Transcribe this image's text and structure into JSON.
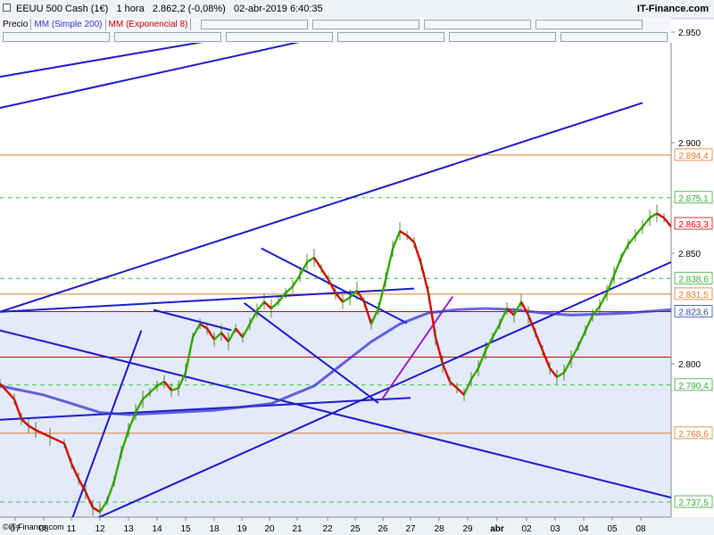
{
  "header": {
    "symbol": "EEUU 500 Cash (1€)",
    "timeframe": "1 hora",
    "price": "2.862,2 (-0,08%)",
    "datetime": "02-abr-2019 6:40:35",
    "brand": "IT-Finance.com"
  },
  "legend": {
    "items": [
      {
        "label": "Precio",
        "color": "#000000"
      },
      {
        "label": "MM (Simple 200)",
        "color": "#3333cc"
      },
      {
        "label": "MM (Exponencial 8)",
        "color": "#cc0000"
      }
    ]
  },
  "footer": {
    "copyright": "©IT-Finance.com"
  },
  "chart_data": {
    "type": "line",
    "x_ticks": [
      "07",
      "08",
      "11",
      "12",
      "13",
      "14",
      "15",
      "18",
      "19",
      "20",
      "21",
      "22",
      "25",
      "26",
      "27",
      "28",
      "29",
      "abr",
      "02",
      "03",
      "04",
      "05",
      "08"
    ],
    "y_ticks": [
      "2.950",
      "2.900",
      "2.850",
      "2.800"
    ],
    "ylim": [
      2730,
      2957
    ],
    "levels": [
      {
        "value": 2894.4,
        "label": "2.894,4",
        "color": "#e07a2a",
        "style": "solid",
        "label_color": "#e07a2a"
      },
      {
        "value": 2875.1,
        "label": "2.875,1",
        "color": "#33cc33",
        "style": "dashed",
        "label_color": "#33aa33"
      },
      {
        "value": 2863.3,
        "label": "2.863,3",
        "color": "#cc0000",
        "style": "none",
        "label_color": "#cc0000"
      },
      {
        "value": 2838.6,
        "label": "2.838,6",
        "color": "#33cc33",
        "style": "dashed",
        "label_color": "#33aa33"
      },
      {
        "value": 2831.5,
        "label": "2.831,5",
        "color": "#e07a2a",
        "style": "solid",
        "label_color": "#e07a2a"
      },
      {
        "value": 2823.6,
        "label": "2.823,6",
        "color": "#cc0000",
        "style": "solid",
        "label_color": "#2244bb"
      },
      {
        "value": 2803.0,
        "label": "",
        "color": "#cc0000",
        "style": "solid",
        "label_color": ""
      },
      {
        "value": 2790.4,
        "label": "2.790,4",
        "color": "#33cc33",
        "style": "dashed",
        "label_color": "#33aa33"
      },
      {
        "value": 2768.6,
        "label": "2.768,6",
        "color": "#e07a2a",
        "style": "solid",
        "label_color": "#e07a2a"
      },
      {
        "value": 2737.5,
        "label": "2.737,5",
        "color": "#33cc33",
        "style": "dashed",
        "label_color": "#33aa33"
      }
    ],
    "series": [
      {
        "name": "Precio",
        "color_up": "#33aa00",
        "color_down": "#dd0000",
        "points": [
          [
            0,
            2791
          ],
          [
            2,
            2784
          ],
          [
            3,
            2775
          ],
          [
            4,
            2772
          ],
          [
            5,
            2770
          ],
          [
            7,
            2767
          ],
          [
            9,
            2764
          ],
          [
            10,
            2755
          ],
          [
            11,
            2748
          ],
          [
            12,
            2742
          ],
          [
            13,
            2735
          ],
          [
            14,
            2733
          ],
          [
            15,
            2738
          ],
          [
            16,
            2747
          ],
          [
            17,
            2760
          ],
          [
            18,
            2770
          ],
          [
            19,
            2778
          ],
          [
            20,
            2784
          ],
          [
            21,
            2787
          ],
          [
            22,
            2790
          ],
          [
            23,
            2792
          ],
          [
            24,
            2788
          ],
          [
            25,
            2789
          ],
          [
            26,
            2796
          ],
          [
            27,
            2812
          ],
          [
            28,
            2818
          ],
          [
            29,
            2816
          ],
          [
            30,
            2811
          ],
          [
            31,
            2814
          ],
          [
            32,
            2810
          ],
          [
            33,
            2816
          ],
          [
            34,
            2812
          ],
          [
            35,
            2818
          ],
          [
            36,
            2824
          ],
          [
            37,
            2828
          ],
          [
            38,
            2825
          ],
          [
            39,
            2828
          ],
          [
            40,
            2832
          ],
          [
            41,
            2835
          ],
          [
            42,
            2840
          ],
          [
            43,
            2846
          ],
          [
            44,
            2848
          ],
          [
            45,
            2843
          ],
          [
            46,
            2838
          ],
          [
            47,
            2832
          ],
          [
            48,
            2828
          ],
          [
            49,
            2830
          ],
          [
            50,
            2833
          ],
          [
            51,
            2828
          ],
          [
            52,
            2818
          ],
          [
            53,
            2825
          ],
          [
            54,
            2838
          ],
          [
            55,
            2852
          ],
          [
            56,
            2860
          ],
          [
            57,
            2858
          ],
          [
            58,
            2855
          ],
          [
            59,
            2845
          ],
          [
            60,
            2832
          ],
          [
            61,
            2812
          ],
          [
            62,
            2800
          ],
          [
            63,
            2792
          ],
          [
            64,
            2789
          ],
          [
            65,
            2786
          ],
          [
            66,
            2793
          ],
          [
            67,
            2798
          ],
          [
            68,
            2806
          ],
          [
            69,
            2812
          ],
          [
            70,
            2818
          ],
          [
            71,
            2825
          ],
          [
            72,
            2822
          ],
          [
            73,
            2828
          ],
          [
            74,
            2822
          ],
          [
            75,
            2814
          ],
          [
            76,
            2806
          ],
          [
            77,
            2798
          ],
          [
            78,
            2794
          ],
          [
            79,
            2796
          ],
          [
            80,
            2802
          ],
          [
            81,
            2808
          ],
          [
            82,
            2815
          ],
          [
            83,
            2822
          ],
          [
            84,
            2826
          ],
          [
            85,
            2832
          ],
          [
            86,
            2840
          ],
          [
            87,
            2848
          ],
          [
            88,
            2854
          ],
          [
            89,
            2858
          ],
          [
            90,
            2862
          ],
          [
            91,
            2866
          ],
          [
            92,
            2868
          ],
          [
            93,
            2866
          ],
          [
            94,
            2862
          ]
        ]
      },
      {
        "name": "MM (Simple 200)",
        "color": "#3333cc",
        "points": [
          [
            0,
            2790
          ],
          [
            6,
            2786
          ],
          [
            10,
            2782
          ],
          [
            14,
            2778
          ],
          [
            18,
            2777
          ],
          [
            24,
            2778
          ],
          [
            30,
            2779
          ],
          [
            38,
            2782
          ],
          [
            44,
            2790
          ],
          [
            48,
            2800
          ],
          [
            52,
            2810
          ],
          [
            56,
            2818
          ],
          [
            60,
            2823
          ],
          [
            64,
            2824.5
          ],
          [
            68,
            2825
          ],
          [
            72,
            2824.5
          ],
          [
            76,
            2823
          ],
          [
            80,
            2822
          ],
          [
            84,
            2822.5
          ],
          [
            88,
            2823
          ],
          [
            92,
            2824
          ],
          [
            94,
            2824.5
          ]
        ]
      }
    ],
    "trendlines": [
      {
        "from": [
          0,
          2929.8
        ],
        "to": [
          49,
          2957
        ],
        "color": "#1a1ac8"
      },
      {
        "from": [
          0,
          2915.7
        ],
        "to": [
          58,
          2957
        ],
        "color": "#1a1ac8"
      },
      {
        "from": [
          0,
          2823.5
        ],
        "to": [
          90,
          2918
        ],
        "color": "#1a1ac8"
      },
      {
        "from": [
          10,
          2725
        ],
        "to": [
          94,
          2846
        ],
        "color": "#1a1ac8"
      },
      {
        "from": [
          0,
          2823.5
        ],
        "to": [
          58,
          2834
        ],
        "color": "#1a1ac8"
      },
      {
        "from": [
          0,
          2774.7
        ],
        "to": [
          57.5,
          2784.6
        ],
        "color": "#1a1ac8"
      },
      {
        "from": [
          0,
          2815.1
        ],
        "to": [
          94,
          2739.5
        ],
        "color": "#1a1ac8"
      },
      {
        "from": [
          36.6,
          2852.2
        ],
        "to": [
          57,
          2818.4
        ],
        "color": "#1a1ac8"
      },
      {
        "from": [
          21.5,
          2824.4
        ],
        "to": [
          32.4,
          2815.2
        ],
        "color": "#1a1ac8"
      },
      {
        "from": [
          10,
          2729
        ],
        "to": [
          19.8,
          2815.1
        ],
        "color": "#1a1ac8"
      },
      {
        "from": [
          34.2,
          2827.5
        ],
        "to": [
          53,
          2782.3
        ],
        "color": "#1a1ac8"
      },
      {
        "from": [
          53.4,
          2783.5
        ],
        "to": [
          63.4,
          2830.4
        ],
        "color": "#9a22c8"
      }
    ]
  }
}
